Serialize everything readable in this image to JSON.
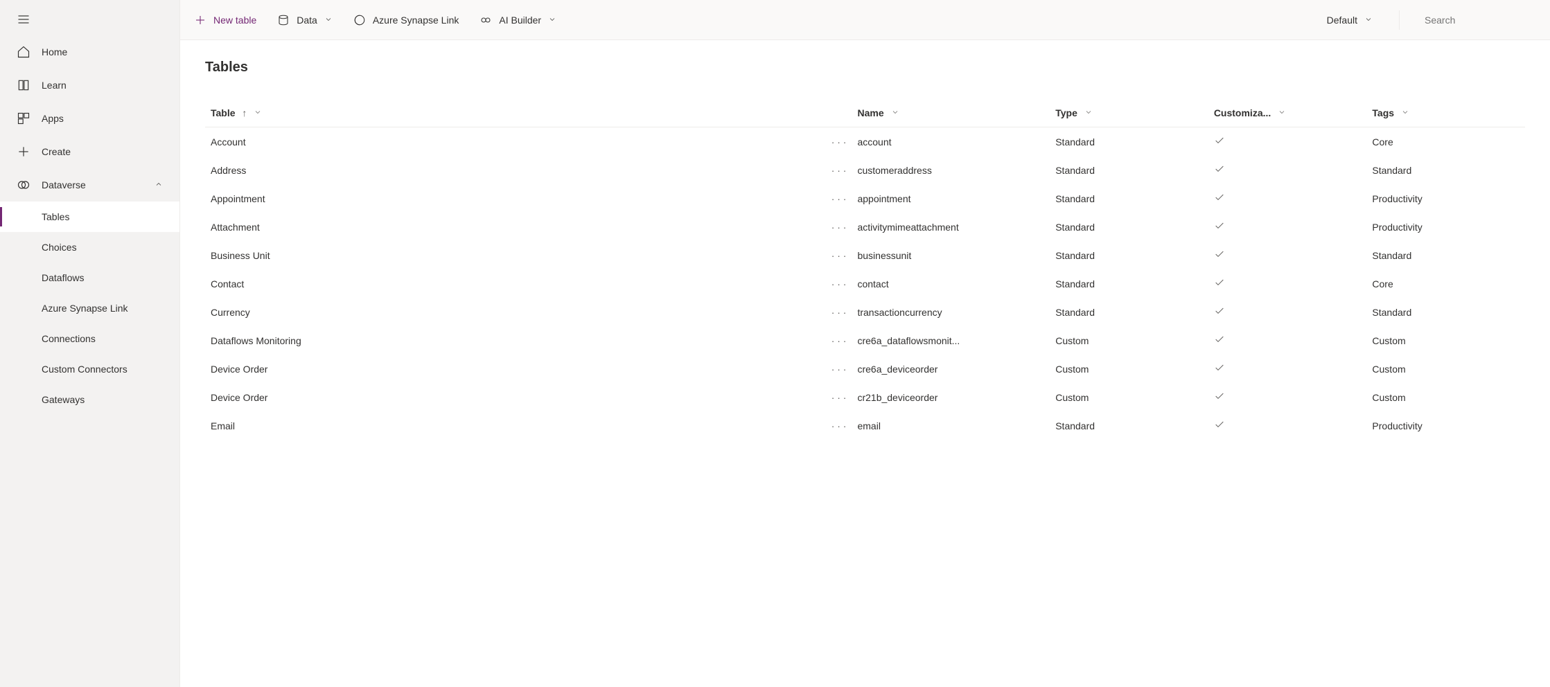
{
  "sidebar": {
    "items": [
      {
        "label": "Home"
      },
      {
        "label": "Learn"
      },
      {
        "label": "Apps"
      },
      {
        "label": "Create"
      },
      {
        "label": "Dataverse"
      }
    ],
    "dataverse_sub": [
      {
        "label": "Tables"
      },
      {
        "label": "Choices"
      },
      {
        "label": "Dataflows"
      },
      {
        "label": "Azure Synapse Link"
      },
      {
        "label": "Connections"
      },
      {
        "label": "Custom Connectors"
      },
      {
        "label": "Gateways"
      }
    ]
  },
  "cmdbar": {
    "new_table": "New table",
    "data": "Data",
    "synapse": "Azure Synapse Link",
    "ai_builder": "AI Builder",
    "environment": "Default",
    "search_placeholder": "Search"
  },
  "page": {
    "title": "Tables"
  },
  "columns": {
    "table": "Table",
    "name": "Name",
    "type": "Type",
    "customizable": "Customiza...",
    "tags": "Tags"
  },
  "rows": [
    {
      "table": "Account",
      "name": "account",
      "type": "Standard",
      "tags": "Core"
    },
    {
      "table": "Address",
      "name": "customeraddress",
      "type": "Standard",
      "tags": "Standard"
    },
    {
      "table": "Appointment",
      "name": "appointment",
      "type": "Standard",
      "tags": "Productivity"
    },
    {
      "table": "Attachment",
      "name": "activitymimeattachment",
      "type": "Standard",
      "tags": "Productivity"
    },
    {
      "table": "Business Unit",
      "name": "businessunit",
      "type": "Standard",
      "tags": "Standard"
    },
    {
      "table": "Contact",
      "name": "contact",
      "type": "Standard",
      "tags": "Core"
    },
    {
      "table": "Currency",
      "name": "transactioncurrency",
      "type": "Standard",
      "tags": "Standard"
    },
    {
      "table": "Dataflows Monitoring",
      "name": "cre6a_dataflowsmonit...",
      "type": "Custom",
      "tags": "Custom"
    },
    {
      "table": "Device Order",
      "name": "cre6a_deviceorder",
      "type": "Custom",
      "tags": "Custom"
    },
    {
      "table": "Device Order",
      "name": "cr21b_deviceorder",
      "type": "Custom",
      "tags": "Custom"
    },
    {
      "table": "Email",
      "name": "email",
      "type": "Standard",
      "tags": "Productivity"
    }
  ]
}
